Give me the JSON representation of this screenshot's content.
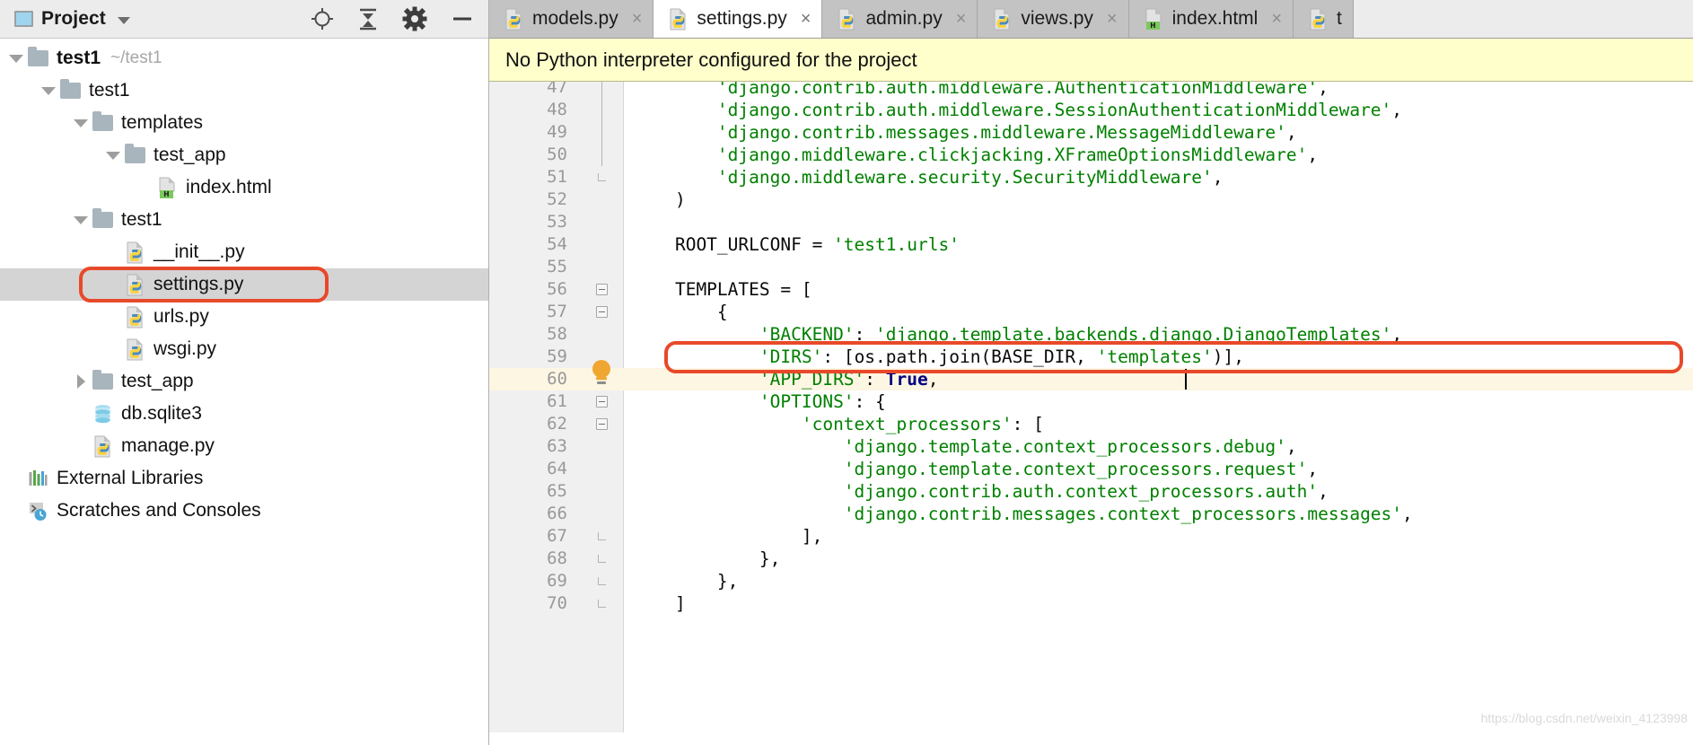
{
  "project_panel": {
    "title": "Project",
    "icon": "project-window-icon",
    "dropdown_icon": "chevron-down-icon",
    "toolbar": [
      {
        "name": "locate-icon",
        "glyph": "target"
      },
      {
        "name": "collapse-all-icon",
        "glyph": "collapse"
      },
      {
        "name": "gear-icon",
        "glyph": "gear"
      },
      {
        "name": "minimize-icon",
        "glyph": "minus"
      }
    ],
    "tree": [
      {
        "label": "test1",
        "sub": "~/test1",
        "icon": "folder-icon",
        "twisty": "open",
        "indent": 0,
        "bold": true,
        "selected": false
      },
      {
        "label": "test1",
        "sub": "",
        "icon": "folder-icon",
        "twisty": "open",
        "indent": 1,
        "bold": false,
        "selected": false
      },
      {
        "label": "templates",
        "sub": "",
        "icon": "folder-icon",
        "twisty": "open",
        "indent": 2,
        "bold": false,
        "selected": false
      },
      {
        "label": "test_app",
        "sub": "",
        "icon": "folder-icon",
        "twisty": "open",
        "indent": 3,
        "bold": false,
        "selected": false
      },
      {
        "label": "index.html",
        "sub": "",
        "icon": "html-file-icon",
        "twisty": "none",
        "indent": 4,
        "bold": false,
        "selected": false
      },
      {
        "label": "test1",
        "sub": "",
        "icon": "folder-icon",
        "twisty": "open",
        "indent": 2,
        "bold": false,
        "selected": false
      },
      {
        "label": "__init__.py",
        "sub": "",
        "icon": "python-file-icon",
        "twisty": "none",
        "indent": 3,
        "bold": false,
        "selected": false
      },
      {
        "label": "settings.py",
        "sub": "",
        "icon": "python-file-icon",
        "twisty": "none",
        "indent": 3,
        "bold": false,
        "selected": true
      },
      {
        "label": "urls.py",
        "sub": "",
        "icon": "python-file-icon",
        "twisty": "none",
        "indent": 3,
        "bold": false,
        "selected": false
      },
      {
        "label": "wsgi.py",
        "sub": "",
        "icon": "python-file-icon",
        "twisty": "none",
        "indent": 3,
        "bold": false,
        "selected": false
      },
      {
        "label": "test_app",
        "sub": "",
        "icon": "folder-icon",
        "twisty": "closed",
        "indent": 2,
        "bold": false,
        "selected": false
      },
      {
        "label": "db.sqlite3",
        "sub": "",
        "icon": "database-icon",
        "twisty": "none",
        "indent": 2,
        "bold": false,
        "selected": false
      },
      {
        "label": "manage.py",
        "sub": "",
        "icon": "python-file-icon",
        "twisty": "none",
        "indent": 2,
        "bold": false,
        "selected": false
      },
      {
        "label": "External Libraries",
        "sub": "",
        "icon": "libraries-icon",
        "twisty": "none",
        "indent": 0,
        "bold": false,
        "selected": false
      },
      {
        "label": "Scratches and Consoles",
        "sub": "",
        "icon": "scratches-icon",
        "twisty": "none",
        "indent": 0,
        "bold": false,
        "selected": false
      }
    ]
  },
  "editor": {
    "tabs": [
      {
        "label": "models.py",
        "icon": "python-file-icon",
        "active": false,
        "close_icon": "close-icon"
      },
      {
        "label": "settings.py",
        "icon": "python-file-icon",
        "active": true,
        "close_icon": "close-icon"
      },
      {
        "label": "admin.py",
        "icon": "python-file-icon",
        "active": false,
        "close_icon": "close-icon"
      },
      {
        "label": "views.py",
        "icon": "python-file-icon",
        "active": false,
        "close_icon": "close-icon"
      },
      {
        "label": "index.html",
        "icon": "html-file-icon",
        "active": false,
        "close_icon": "close-icon"
      },
      {
        "label": "t",
        "icon": "python-file-icon",
        "active": false,
        "close_icon": "close-icon"
      }
    ],
    "banner": {
      "message": "No Python interpreter configured for the project"
    },
    "first_line_number": 47,
    "highlighted_line_number": 60,
    "bulb_line_number": 60,
    "lines": [
      {
        "n": 47,
        "text": "        'django.contrib.auth.middleware.AuthenticationMiddleware',",
        "fold": "tail"
      },
      {
        "n": 48,
        "text": "        'django.contrib.auth.middleware.SessionAuthenticationMiddleware',",
        "fold": "tail"
      },
      {
        "n": 49,
        "text": "        'django.contrib.messages.middleware.MessageMiddleware',",
        "fold": "tail"
      },
      {
        "n": 50,
        "text": "        'django.middleware.clickjacking.XFrameOptionsMiddleware',",
        "fold": "tail"
      },
      {
        "n": 51,
        "text": "        'django.middleware.security.SecurityMiddleware',",
        "fold": "end"
      },
      {
        "n": 52,
        "text": "    )",
        "fold": "none"
      },
      {
        "n": 53,
        "text": "",
        "fold": "none"
      },
      {
        "n": 54,
        "text": "    ROOT_URLCONF = 'test1.urls'",
        "fold": "none"
      },
      {
        "n": 55,
        "text": "",
        "fold": "none"
      },
      {
        "n": 56,
        "text": "    TEMPLATES = [",
        "fold": "minus"
      },
      {
        "n": 57,
        "text": "        {",
        "fold": "minus"
      },
      {
        "n": 58,
        "text": "            'BACKEND': 'django.template.backends.django.DjangoTemplates',",
        "fold": "none"
      },
      {
        "n": 59,
        "text": "            'DIRS': [os.path.join(BASE_DIR, 'templates')],",
        "fold": "none"
      },
      {
        "n": 60,
        "text": "            'APP_DIRS': True,",
        "fold": "none"
      },
      {
        "n": 61,
        "text": "            'OPTIONS': {",
        "fold": "minus"
      },
      {
        "n": 62,
        "text": "                'context_processors': [",
        "fold": "minus"
      },
      {
        "n": 63,
        "text": "                    'django.template.context_processors.debug',",
        "fold": "none"
      },
      {
        "n": 64,
        "text": "                    'django.template.context_processors.request',",
        "fold": "none"
      },
      {
        "n": 65,
        "text": "                    'django.contrib.auth.context_processors.auth',",
        "fold": "none"
      },
      {
        "n": 66,
        "text": "                    'django.contrib.messages.context_processors.messages',",
        "fold": "none"
      },
      {
        "n": 67,
        "text": "                ],",
        "fold": "end"
      },
      {
        "n": 68,
        "text": "            },",
        "fold": "end"
      },
      {
        "n": 69,
        "text": "        },",
        "fold": "end"
      },
      {
        "n": 70,
        "text": "    ]",
        "fold": "end"
      }
    ],
    "annotations": {
      "dirs_highlight_line": 59,
      "bulb_icon": "lightbulb-icon"
    },
    "watermark": "https://blog.csdn.net/weixin_4123998"
  },
  "colors": {
    "highlight_box": "#e8492a",
    "string": "#008000",
    "keyword": "#000080",
    "banner_bg": "#ffffcc",
    "selection_bg": "#d4d4d4",
    "current_line_bg": "#fdf6e3"
  }
}
